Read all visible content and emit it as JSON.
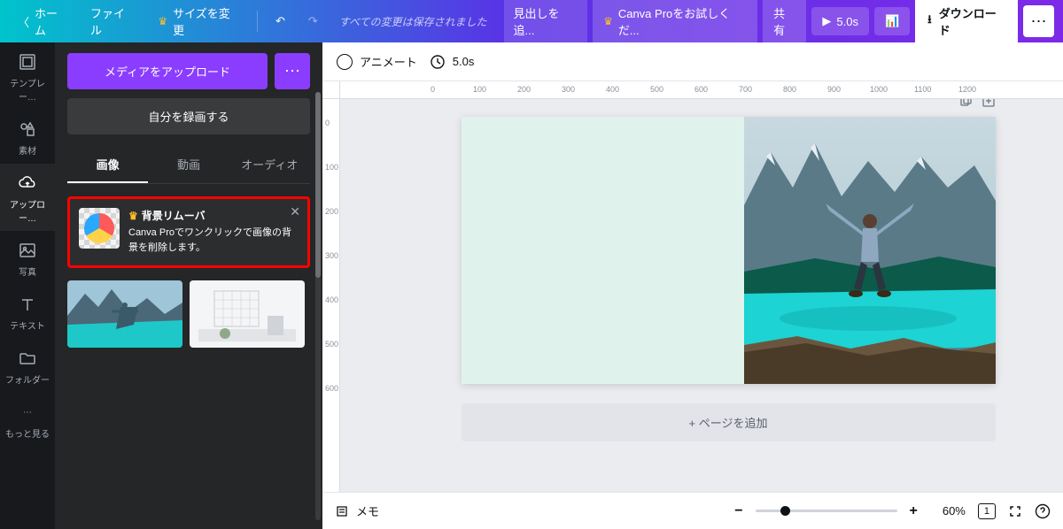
{
  "topbar": {
    "home": "ホーム",
    "file": "ファイル",
    "resize": "サイズを変更",
    "status": "すべての変更は保存されました",
    "title": "見出しを追...",
    "try_pro": "Canva Proをお試しくだ...",
    "share": "共有",
    "play_time": "5.0s",
    "download": "ダウンロード"
  },
  "rail": {
    "template": "テンプレー…",
    "elements": "素材",
    "upload": "アップロー…",
    "photos": "写真",
    "text": "テキスト",
    "folder": "フォルダー",
    "more": "もっと見る"
  },
  "panel": {
    "upload_btn": "メディアをアップロード",
    "record_btn": "自分を録画する",
    "tab_image": "画像",
    "tab_video": "動画",
    "tab_audio": "オーディオ",
    "promo_title": "背景リムーバ",
    "promo_desc": "Canva Proでワンクリックで画像の背景を削除します。"
  },
  "toolbar": {
    "animate": "アニメート",
    "duration": "5.0s"
  },
  "ruler_h": [
    "0",
    "100",
    "200",
    "300",
    "400",
    "500",
    "600",
    "700",
    "800",
    "900",
    "1000",
    "1100",
    "1200"
  ],
  "ruler_v": [
    "0",
    "100",
    "200",
    "300",
    "400",
    "500",
    "600"
  ],
  "add_page": "+ ページを追加",
  "bottom": {
    "memo": "メモ",
    "zoom": "60%",
    "page_ind": "1"
  }
}
